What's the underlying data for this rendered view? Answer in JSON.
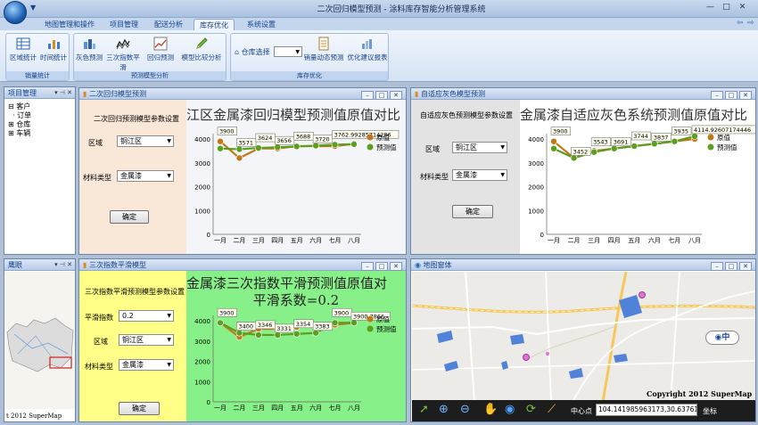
{
  "window": {
    "title": "二次回归模型预测 - 涂料库存智能分析管理系统",
    "min": "—",
    "max": "□",
    "close": "✕"
  },
  "tabs": [
    "地图管理和操作",
    "项目管理",
    "配送分析",
    "库存优化",
    "系统设置"
  ],
  "active_tab": 3,
  "ribbon": {
    "groups": [
      {
        "label": "销量统计",
        "buttons": [
          "区域统计",
          "时间统计"
        ]
      },
      {
        "label": "预测模型分析",
        "buttons": [
          "灰色预测",
          "三次指数平滑",
          "回归预测",
          "模型比较分析"
        ]
      },
      {
        "label": "库存优化",
        "buttons": [
          "销量动态预测",
          "优化建议报表"
        ]
      }
    ],
    "warehouse_label": "仓库选择"
  },
  "project_panel": {
    "title": "项目管理",
    "items": [
      "客户",
      "订单",
      "仓库",
      "车辆"
    ]
  },
  "eagle_panel": {
    "title": "鹰眼",
    "copyright": "t 2012 SuperMap"
  },
  "panels": {
    "regression": {
      "title": "二次回归模型预测",
      "settings_title": "二次回归预测模型参数设置",
      "region_label": "区域",
      "region_value": "铜江区",
      "material_label": "材料类型",
      "material_value": "金属漆",
      "confirm": "确定",
      "chart_title": "江区金属漆回归模型预测值原值对比"
    },
    "grey": {
      "title": "自适应灰色模型预测",
      "settings_title": "自适应灰色预测模型参数设置",
      "region_label": "区域",
      "region_value": "铜江区",
      "material_label": "材料类型",
      "material_value": "金属漆",
      "confirm": "确定",
      "chart_title": "金属漆自适应灰色系统预测值原值对比"
    },
    "smoothing": {
      "title": "三次指数平滑模型",
      "settings_title": "三次指数平滑预测模型参数设置",
      "alpha_label": "平滑指数",
      "alpha_value": "0.2",
      "region_label": "区域",
      "region_value": "铜江区",
      "material_label": "材料类型",
      "material_value": "金属漆",
      "confirm": "确定",
      "chart_title_1": "金属漆三次指数平滑预测值原值对",
      "chart_title_2": "平滑系数=0.2"
    },
    "map": {
      "title": "地图窗体",
      "copyright": "Copyright 2012 SuperMap",
      "coord_label": "中心点",
      "coord_value": "104.141985963173,30.6376196",
      "coord_unit": "坐标",
      "lang_badge": "中"
    }
  },
  "colors": {
    "original": "#c07818",
    "predicted": "#5c9e1e",
    "reg_bg": "#f9e7d8",
    "reg_chart_bg": "#f3f5f8",
    "grey_bg": "#e3e3e3",
    "smooth_bg": "#ffff88",
    "smooth_chart_bg": "#88f088"
  },
  "chart_data": [
    {
      "type": "line",
      "title": "江区金属漆回归模型预测值原值对比",
      "categories": [
        "一月",
        "二月",
        "三月",
        "四月",
        "五月",
        "六月",
        "七月",
        "八月"
      ],
      "ylim": [
        0,
        4000
      ],
      "yticks": [
        0,
        1000,
        2000,
        3000,
        4000
      ],
      "series": [
        {
          "name": "原值",
          "values": [
            3900,
            3200,
            3600,
            3600,
            3700,
            3700,
            3700,
            3800
          ]
        },
        {
          "name": "预测值",
          "values": [
            3600,
            3571,
            3624,
            3656,
            3688,
            3720,
            3762.99285714286,
            3780
          ]
        }
      ],
      "data_labels": [
        "3900",
        "3571",
        "3624",
        "3656",
        "3688",
        "3720",
        "3762.99285714286",
        ""
      ]
    },
    {
      "type": "line",
      "title": "金属漆自适应灰色系统预测值原值对比",
      "categories": [
        "一月",
        "二月",
        "三月",
        "四月",
        "五月",
        "六月",
        "七月",
        "八月"
      ],
      "ylim": [
        0,
        4000
      ],
      "yticks": [
        0,
        1000,
        2000,
        3000,
        4000
      ],
      "series": [
        {
          "name": "原值",
          "values": [
            3900,
            3200,
            3500,
            3600,
            3700,
            3800,
            3900,
            4000
          ]
        },
        {
          "name": "预测值",
          "values": [
            3600,
            3200,
            3450,
            3600,
            3700,
            3800,
            3900,
            4114.92607174446
          ]
        }
      ],
      "data_labels": [
        "3900",
        "3452",
        "3543",
        "3691",
        "3744",
        "3837",
        "3935",
        "4114.92607174446"
      ]
    },
    {
      "type": "line",
      "title": "金属漆三次指数平滑预测值原值对 平滑系数=0.2",
      "categories": [
        "一月",
        "二月",
        "三月",
        "四月",
        "五月",
        "六月",
        "七月",
        "八月"
      ],
      "ylim": [
        0,
        4000
      ],
      "yticks": [
        0,
        1000,
        2000,
        3000,
        4000
      ],
      "series": [
        {
          "name": "原值",
          "values": [
            3900,
            3200,
            3600,
            3600,
            3700,
            3700,
            3800,
            3900
          ]
        },
        {
          "name": "预测值",
          "values": [
            3900,
            3400,
            3300,
            3300,
            3350,
            3400,
            3900,
            3900.7866
          ]
        }
      ],
      "data_labels": [
        "3900",
        "3400",
        "3346",
        "3331",
        "3354",
        "3383",
        "3900",
        "3900.7866"
      ]
    }
  ]
}
